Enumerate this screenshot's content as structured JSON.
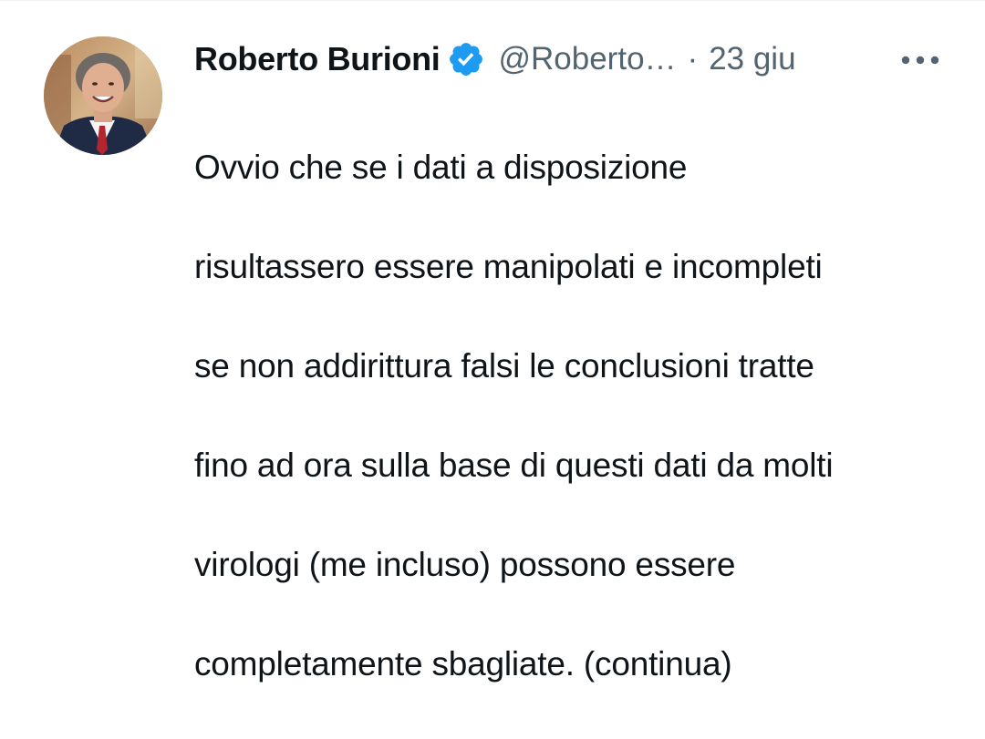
{
  "tweet": {
    "author_name": "Roberto Burioni",
    "handle": "@Roberto…",
    "separator": "·",
    "time": "23 giu",
    "verified_icon": "verified-badge-icon",
    "more_icon": "more-horizontal-icon",
    "lines": [
      "Ovvio che se i dati a disposizione",
      "risultassero essere manipolati e incompleti",
      "se non addirittura falsi le conclusioni tratte",
      "fino ad ora sulla base di questi dati da molti",
      "virologi (me incluso) possono essere",
      "completamente sbagliate. (continua)"
    ]
  },
  "colors": {
    "text_primary": "#0f1419",
    "text_secondary": "#536471",
    "verified_blue": "#1d9bf0",
    "background": "#ffffff"
  }
}
